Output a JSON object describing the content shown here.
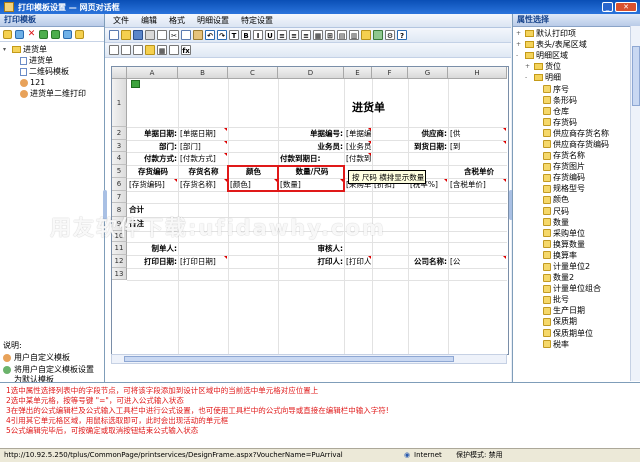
{
  "window": {
    "title": "打印模板设置  —  网页对话框"
  },
  "left_panel": {
    "header": "打印模板",
    "tree": [
      {
        "label": "进货单",
        "level": 0,
        "icon": "folder"
      },
      {
        "label": "进货单",
        "level": 1,
        "icon": "doc"
      },
      {
        "label": "二维码模板",
        "level": 1,
        "icon": "doc"
      },
      {
        "label": "121",
        "level": 1,
        "icon": "user"
      },
      {
        "label": "进货单二维打印",
        "level": 1,
        "icon": "user"
      }
    ],
    "legend_title": "说明:",
    "legend_items": [
      "用户自定义模板",
      "将用户自定义模板设置为默认模板"
    ]
  },
  "menu": [
    "文件",
    "编辑",
    "格式",
    "明细设置",
    "特定设置"
  ],
  "sheet": {
    "col_headers": [
      "A",
      "B",
      "C",
      "D",
      "E",
      "F",
      "G",
      "H"
    ],
    "row_headers": [
      "1",
      "2",
      "3",
      "4",
      "5",
      "6",
      "7",
      "8",
      "9",
      "10",
      "11",
      "12",
      "13"
    ],
    "title": "进货单",
    "cells": {
      "r2a": "单据日期:",
      "r2b": "[单据日期]",
      "r2d": "单据编号:",
      "r2e": "[单据编号]",
      "r2g": "供应商:",
      "r2h": "[供",
      "r3a": "部门:",
      "r3b": "[部门]",
      "r3d": "业务员:",
      "r3e": "[业务员]",
      "r3g": "到货日期:",
      "r3h": "[到",
      "r4a": "付款方式:",
      "r4b": "[付款方式]",
      "r4d": "付款到期日:",
      "r4e": "[付款到期",
      "r5a": "存货编码",
      "r5b": "存货名称",
      "r5c": "颜色",
      "r5d": "数量/尺码",
      "r5h": "含税单价",
      "r6a": "[存货编码]",
      "r6b": "[存货名称]",
      "r6c": "[颜色]",
      "r6d": "[数量]",
      "r6e": "[采购单价]",
      "r6f": "[折扣]",
      "r6g": "[税率%]",
      "r6h": "[含税单价]",
      "r8a": "合计",
      "r9a": "备注",
      "r11a": "制单人:",
      "r11d": "审核人:",
      "r12a": "打印日期:",
      "r12b": "[打印日期]",
      "r12d": "打印人:",
      "r12e": "[打印人]",
      "r12g": "公司名称:",
      "r12h": "[公"
    },
    "tooltip": "按 尺码 横排显示数量"
  },
  "watermark": "用友软件下载:ufidawhy.com",
  "right_panel": {
    "header": "属性选择",
    "tree": [
      {
        "label": "默认打印项",
        "level": 0,
        "icon": "folder",
        "expand": "+"
      },
      {
        "label": "表头/表尾区域",
        "level": 0,
        "icon": "folder",
        "expand": "+"
      },
      {
        "label": "明细区域",
        "level": 0,
        "icon": "folder",
        "expand": "-"
      },
      {
        "label": "货位",
        "level": 1,
        "icon": "folder",
        "expand": "+"
      },
      {
        "label": "明细",
        "level": 1,
        "icon": "folder",
        "expand": "-"
      },
      {
        "label": "序号",
        "level": 2,
        "icon": "item"
      },
      {
        "label": "条形码",
        "level": 2,
        "icon": "item"
      },
      {
        "label": "仓库",
        "level": 2,
        "icon": "item"
      },
      {
        "label": "存货码",
        "level": 2,
        "icon": "item"
      },
      {
        "label": "供应商存货名称",
        "level": 2,
        "icon": "item"
      },
      {
        "label": "供应商存货编码",
        "level": 2,
        "icon": "item"
      },
      {
        "label": "存货名称",
        "level": 2,
        "icon": "item"
      },
      {
        "label": "存货图片",
        "level": 2,
        "icon": "item"
      },
      {
        "label": "存货编码",
        "level": 2,
        "icon": "item"
      },
      {
        "label": "规格型号",
        "level": 2,
        "icon": "item"
      },
      {
        "label": "颜色",
        "level": 2,
        "icon": "item"
      },
      {
        "label": "尺码",
        "level": 2,
        "icon": "item"
      },
      {
        "label": "数量",
        "level": 2,
        "icon": "item"
      },
      {
        "label": "采购单位",
        "level": 2,
        "icon": "item"
      },
      {
        "label": "换算数量",
        "level": 2,
        "icon": "item"
      },
      {
        "label": "换算率",
        "level": 2,
        "icon": "item"
      },
      {
        "label": "计量单位2",
        "level": 2,
        "icon": "item"
      },
      {
        "label": "数量2",
        "level": 2,
        "icon": "item"
      },
      {
        "label": "计量单位组合",
        "level": 2,
        "icon": "item"
      },
      {
        "label": "批号",
        "level": 2,
        "icon": "item"
      },
      {
        "label": "生产日期",
        "level": 2,
        "icon": "item"
      },
      {
        "label": "保质期",
        "level": 2,
        "icon": "item"
      },
      {
        "label": "保质期单位",
        "level": 2,
        "icon": "item"
      },
      {
        "label": "税率",
        "level": 2,
        "icon": "item"
      }
    ]
  },
  "instructions": [
    "1选中属性选择列表中的字段节点，可将该字段添加到设计区域中的当前选中单元格对应位置上",
    "2选中某单元格，按等号键 \"=\"，可进入公式输入状态",
    "3在弹出的公式编辑栏及公式输入工具栏中进行公式设置，也可使用工具栏中的公式向导或直接在编辑栏中输入字符!",
    "4引用其它单元格区域，用鼠标选取即可，此时会出现活动的单元框",
    "5公式编辑完毕后，可按确定或取消按钮结束公式输入状态"
  ],
  "status": {
    "url": "http://10.92.5.250/tplus/CommonPage/printservices/DesignFrame.aspx?VoucherName=PuArrival",
    "zone": "Internet",
    "protected": "保护模式: 禁用"
  }
}
